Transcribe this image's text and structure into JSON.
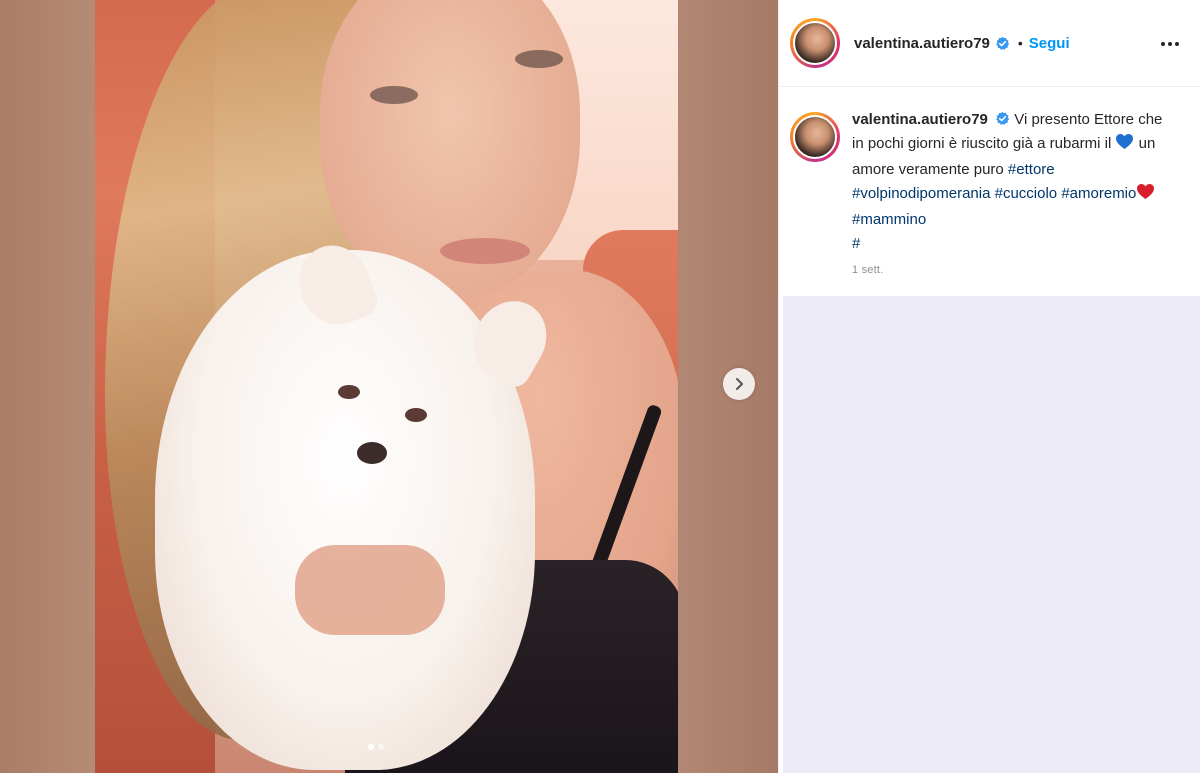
{
  "post": {
    "media": {
      "description_icon": "carousel-next-icon",
      "carousel": {
        "total": 2,
        "active_index": 0
      }
    },
    "header": {
      "username": "valentina.autiero79",
      "separator": "•",
      "follow_label": "Segui",
      "more_icon": "more-options-icon"
    },
    "caption": {
      "username": "valentina.autiero79",
      "text_1": " Vi presento Ettore che in pochi giorni è riuscito già a rubarmi il ",
      "text_2": " un amore veramente puro ",
      "tags": [
        "#ettore",
        "#volpinodipomerania",
        "#cucciolo",
        "#amoremio",
        "#mammino",
        "#"
      ],
      "time": "1 sett."
    },
    "colors": {
      "link_blue": "#0095f6",
      "hashtag": "#00376b",
      "verified": "#3897f0",
      "muted": "#8e8e8e",
      "empty_area": "#eeebf9"
    }
  }
}
